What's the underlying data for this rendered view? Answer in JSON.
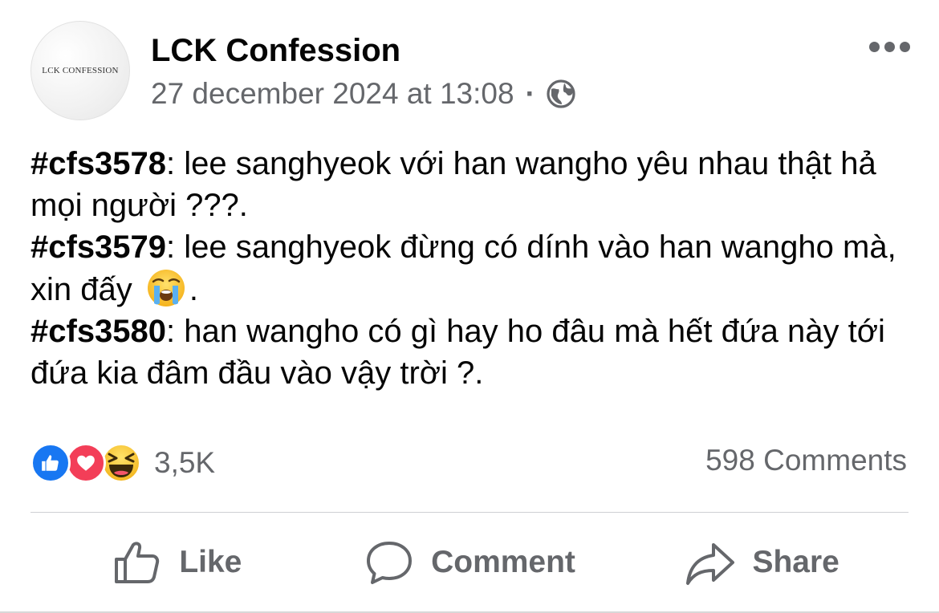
{
  "post": {
    "avatar_text": "LCK CONFESSION",
    "page_name": "LCK Confession",
    "timestamp": "27 december 2024 at 13:08",
    "separator": "·",
    "privacy_icon": "globe-icon",
    "more_icon": "more-options-icon",
    "paragraphs": [
      {
        "tag": "#cfs3578",
        "text": ": lee sanghyeok với han wangho yêu nhau thật hả mọi người ???."
      },
      {
        "tag": "#cfs3579",
        "text": ": lee sanghyeok đừng có dính vào han wangho mà, xin đấy",
        "emoji": "loudly-crying-face-icon",
        "suffix": "."
      },
      {
        "tag": "#cfs3580",
        "text": ": han wangho có gì hay ho đâu mà hết đứa này tới đứa kia đâm đầu vào vậy trời ?."
      }
    ]
  },
  "stats": {
    "reaction_icons": [
      "like-reaction-icon",
      "love-reaction-icon",
      "haha-reaction-icon"
    ],
    "reaction_count": "3,5K",
    "comments_count": "598 Comments"
  },
  "actions": {
    "like_label": "Like",
    "comment_label": "Comment",
    "share_label": "Share"
  },
  "colors": {
    "text_primary": "#050505",
    "text_secondary": "#65676b",
    "like_blue": "#1877f2",
    "love_red": "#f33e58",
    "haha_yellow": "#f7c935",
    "divider": "#ced0d4"
  }
}
